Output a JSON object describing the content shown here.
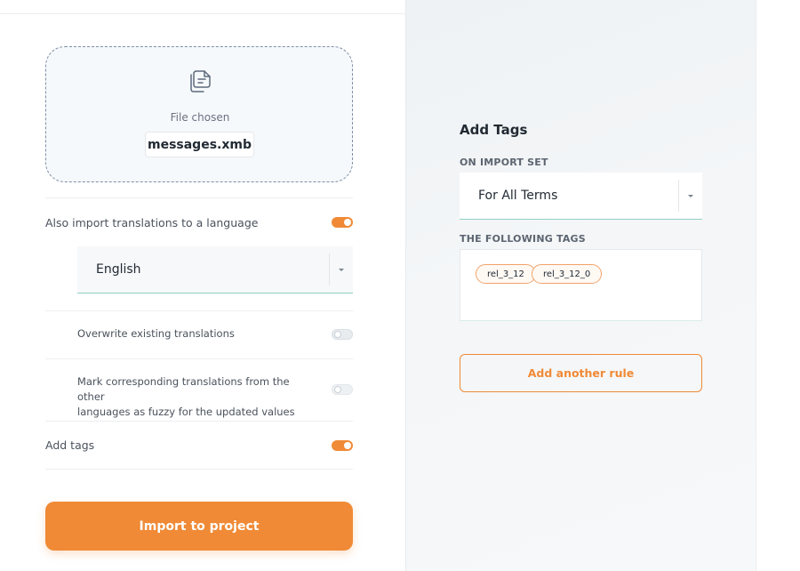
{
  "upload": {
    "icon": "file-copy-icon",
    "status_label": "File chosen",
    "file_name": "messages.xmb"
  },
  "options": {
    "import_translations_label": "Also import translations to a language",
    "import_translations_on": true,
    "language_value": "English",
    "overwrite_label": "Overwrite existing translations",
    "overwrite_on": false,
    "fuzzy_label_line1": "Mark corresponding translations from the other",
    "fuzzy_label_line2": "languages as fuzzy for the updated values",
    "fuzzy_on": false,
    "add_tags_label": "Add tags",
    "add_tags_on": true
  },
  "actions": {
    "import_label": "Import to project"
  },
  "tags_panel": {
    "title": "Add Tags",
    "on_import_set_label": "ON IMPORT SET",
    "on_import_set_value": "For All Terms",
    "following_tags_label": "THE FOLLOWING TAGS",
    "tags": [
      "rel_3_12",
      "rel_3_12_0"
    ],
    "add_rule_label": "Add another rule"
  },
  "colors": {
    "accent": "#f08a36",
    "focus_underline": "#8fd0c3"
  }
}
